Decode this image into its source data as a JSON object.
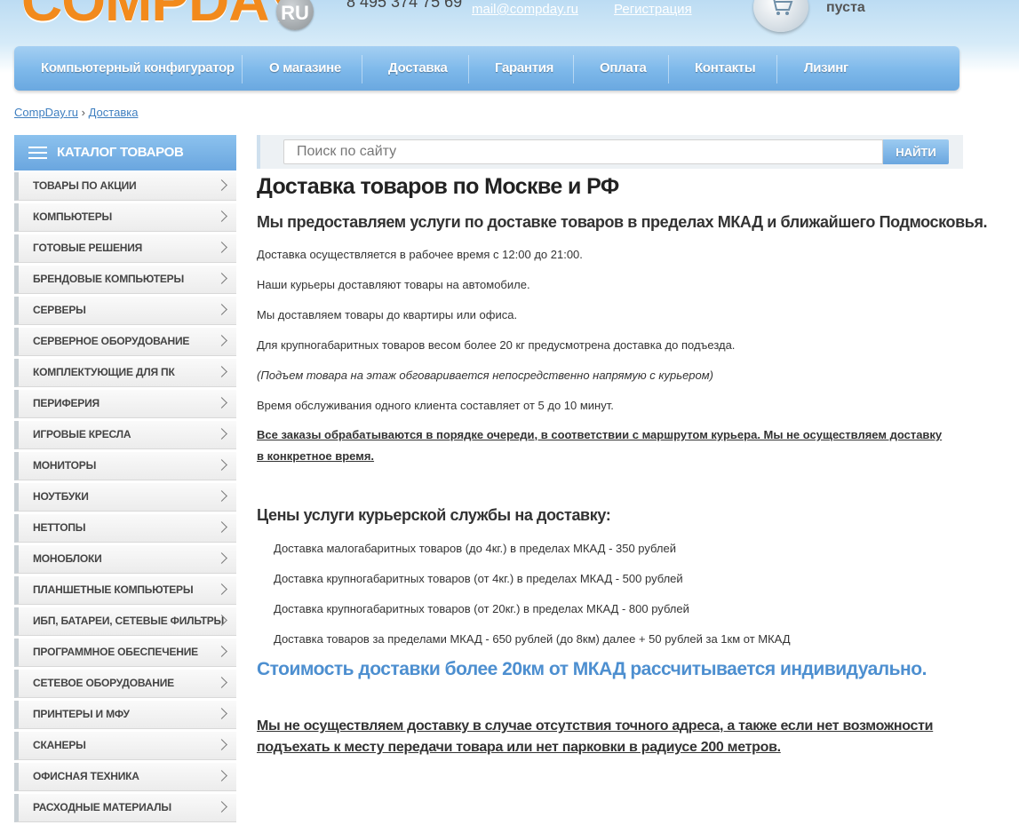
{
  "header": {
    "logo_text": "COMPDAY",
    "logo_suffix": "RU",
    "phone": "8 495 374 75 69",
    "email_link": "mail@compday.ru",
    "register_link": "Регистрация",
    "cart_status": "пуста"
  },
  "nav": {
    "items": [
      "Компьютерный конфигуратор",
      "О магазине",
      "Доставка",
      "Гарантия",
      "Оплата",
      "Контакты",
      "Лизинг"
    ]
  },
  "breadcrumb": {
    "home": "CompDay.ru",
    "separator": "›",
    "current": "Доставка"
  },
  "catalog": {
    "title": "КАТАЛОГ ТОВАРОВ",
    "items": [
      "ТОВАРЫ ПО АКЦИИ",
      "КОМПЬЮТЕРЫ",
      "ГОТОВЫЕ РЕШЕНИЯ",
      "БРЕНДОВЫЕ КОМПЬЮТЕРЫ",
      "СЕРВЕРЫ",
      "СЕРВЕРНОЕ ОБОРУДОВАНИЕ",
      "КОМПЛЕКТУЮЩИЕ ДЛЯ ПК",
      "ПЕРИФЕРИЯ",
      "ИГРОВЫЕ КРЕСЛА",
      "МОНИТОРЫ",
      "НОУТБУКИ",
      "НЕТТОПЫ",
      "МОНОБЛОКИ",
      "ПЛАНШЕТНЫЕ КОМПЬЮТЕРЫ",
      "ИБП, БАТАРЕИ, СЕТЕВЫЕ ФИЛЬТРЫ",
      "ПРОГРАММНОЕ ОБЕСПЕЧЕНИЕ",
      "СЕТЕВОЕ ОБОРУДОВАНИЕ",
      "ПРИНТЕРЫ И МФУ",
      "СКАНЕРЫ",
      "ОФИСНАЯ ТЕХНИКА",
      "РАСХОДНЫЕ МАТЕРИАЛЫ"
    ]
  },
  "search": {
    "placeholder": "Поиск по сайту",
    "button": "НАЙТИ"
  },
  "content": {
    "title": "Доставка товаров по Москве и РФ",
    "subtitle": "Мы предоставляем услуги по доставке товаров в пределах МКАД и ближайшего Подмосковья.",
    "paragraphs": [
      "Доставка осуществляется в рабочее время с 12:00 до 21:00.",
      "Наши курьеры доставляют товары на автомобиле.",
      "Мы доставляем товары до квартиры или офиса.",
      "Для крупногабаритных товаров весом более 20 кг предусмотрена доставка до подъезда.",
      "(Подъем товара на этаж обговаривается непосредственно напрямую с курьером)",
      "Время обслуживания одного клиента составляет от 5 до 10 минут.",
      "Все заказы обрабатываются в порядке очереди, в соответствии с маршрутом курьера. Мы не осуществляем доставку в конкретное время."
    ],
    "prices_title": "Цены услуги курьерской службы на доставку:",
    "prices": [
      "Доставка малогабаритных товаров (до 4кг.) в пределах МКАД - 350 рублей",
      "Доставка крупногабаритных товаров (от 4кг.) в пределах МКАД - 500 рублей",
      "Доставка крупногабаритных товаров (от 20кг.) в пределах МКАД - 800 рублей",
      "Доставка товаров за пределами МКАД - 650 рублей (до 8км) далее + 50 рублей за 1км от МКАД"
    ],
    "highlight": "Стоимость доставки более 20км от МКАД рассчитывается индивидуально.",
    "warning": "Мы не осуществляем доставку в случае отсутствия точного адреса, а также если нет возможности подъехать к месту передачи товара или нет парковки в радиусе 200 метров."
  },
  "colors": {
    "brand_orange": "#f28a1c",
    "nav_blue": "#7db8ea",
    "link_blue": "#3f7fc0",
    "highlight_blue": "#4d8fd0"
  }
}
